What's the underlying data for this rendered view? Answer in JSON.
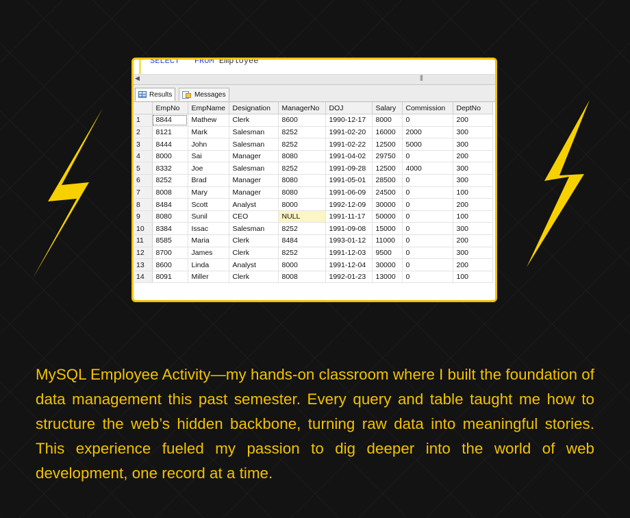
{
  "query": {
    "keyword_select": "SELECT",
    "star": "*",
    "keyword_from": "FROM",
    "table": "Employee"
  },
  "tabs": {
    "results": "Results",
    "messages": "Messages"
  },
  "table": {
    "columns": [
      "EmpNo",
      "EmpName",
      "Designation",
      "ManagerNo",
      "DOJ",
      "Salary",
      "Commission",
      "DeptNo"
    ],
    "rows": [
      [
        "1",
        "8844",
        "Mathew",
        "Clerk",
        "8600",
        "1990-12-17",
        "8000",
        "0",
        "200"
      ],
      [
        "2",
        "8121",
        "Mark",
        "Salesman",
        "8252",
        "1991-02-20",
        "16000",
        "2000",
        "300"
      ],
      [
        "3",
        "8444",
        "John",
        "Salesman",
        "8252",
        "1991-02-22",
        "12500",
        "5000",
        "300"
      ],
      [
        "4",
        "8000",
        "Sai",
        "Manager",
        "8080",
        "1991-04-02",
        "29750",
        "0",
        "200"
      ],
      [
        "5",
        "8332",
        "Joe",
        "Salesman",
        "8252",
        "1991-09-28",
        "12500",
        "4000",
        "300"
      ],
      [
        "6",
        "8252",
        "Brad",
        "Manager",
        "8080",
        "1991-05-01",
        "28500",
        "0",
        "300"
      ],
      [
        "7",
        "8008",
        "Mary",
        "Manager",
        "8080",
        "1991-06-09",
        "24500",
        "0",
        "100"
      ],
      [
        "8",
        "8484",
        "Scott",
        "Analyst",
        "8000",
        "1992-12-09",
        "30000",
        "0",
        "200"
      ],
      [
        "9",
        "8080",
        "Sunil",
        "CEO",
        "NULL",
        "1991-11-17",
        "50000",
        "0",
        "100"
      ],
      [
        "10",
        "8384",
        "Issac",
        "Salesman",
        "8252",
        "1991-09-08",
        "15000",
        "0",
        "300"
      ],
      [
        "11",
        "8585",
        "Maria",
        "Clerk",
        "8484",
        "1993-01-12",
        "11000",
        "0",
        "200"
      ],
      [
        "12",
        "8700",
        "James",
        "Clerk",
        "8252",
        "1991-12-03",
        "9500",
        "0",
        "300"
      ],
      [
        "13",
        "8600",
        "Linda",
        "Analyst",
        "8000",
        "1991-12-04",
        "30000",
        "0",
        "200"
      ],
      [
        "14",
        "8091",
        "Miller",
        "Clerk",
        "8008",
        "1992-01-23",
        "13000",
        "0",
        "100"
      ]
    ]
  },
  "caption": "MySQL Employee Activity—my hands-on classroom where I built the foundation of data management this past semester. Every query and table taught me how to structure the web’s hidden backbone, turning raw data into meaningful stories. This experience fueled my passion to dig deeper into the world of web development, one record at a time.",
  "colors": {
    "accent": "#f3c300",
    "background": "#131313"
  },
  "icons": {
    "left": "lightning-bolt-icon",
    "right": "lightning-bolt-icon"
  }
}
